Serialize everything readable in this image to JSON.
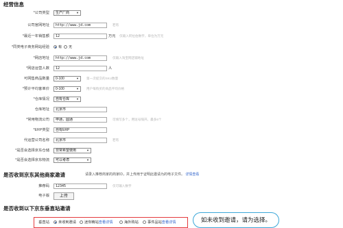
{
  "sections": {
    "business": "经营信息",
    "invite_other": "是否收到京东其他商家邀请",
    "invite_vertical": "是否收到以下京东垂直站邀请"
  },
  "fields": {
    "company_type": {
      "label": "*公司类型",
      "value": "生产厂商"
    },
    "website": {
      "label": "公司官网地址",
      "value": "http://www.jd.com",
      "hint": "若有"
    },
    "sales": {
      "label": "*最近一年销售额",
      "value": "12",
      "unit": "万元",
      "hint": "仅输入阿拉伯数字，单位为万元"
    },
    "online_store": {
      "label": "*同类电子商务网站经验",
      "yes": "有",
      "no": "无"
    },
    "store_url": {
      "label": "*网店地址",
      "value": "http://www.jd.com",
      "hint": "仅输入淘宝网店铺地址"
    },
    "ops_staff": {
      "label": "*网店运营人数",
      "value": "12",
      "unit": "人"
    },
    "sku_count": {
      "label": "可网售商品数量",
      "value": "0-100",
      "hint": "第一次提交的SKU数量"
    },
    "avg_price": {
      "label": "*预计平均客单价",
      "value": "0-100",
      "hint": "用户每购买的商品平均价格"
    },
    "warehouse": {
      "label": "*仓库情况",
      "value": "自有仓库"
    },
    "warehouse_addr": {
      "label": "仓库地址",
      "value": "北京市"
    },
    "courier": {
      "label": "*常用物流公司",
      "value": "申通，圆通",
      "hint": "可填写多个，用逗号隔开。最多5个"
    },
    "erp": {
      "label": "*ERP类型",
      "value": "自有ERP"
    },
    "agent": {
      "label": "代运营公司名称",
      "value": "北京市",
      "hint": "若有"
    },
    "jd_warehouse": {
      "label": "*是否会选择京东仓储",
      "value": "非常希望使用"
    },
    "jd_logistics": {
      "label": "*是否会选择京东物流",
      "value": "可以考虑"
    }
  },
  "invite_other": {
    "desc": "请录入推荐商家的商家ID，并上传用于证明此邀请为的电子文件。",
    "desc_link": "详情查看",
    "code": {
      "label": "推荐码",
      "value": "12345",
      "hint": "仅可输入数字"
    },
    "file": {
      "label": "电子版",
      "button": "上传"
    }
  },
  "invite_vertical": {
    "label": "垂直站",
    "options": [
      {
        "text": "未收到邀请",
        "link": "",
        "checked": true
      },
      {
        "text": "迷你精站",
        "link": "查看详情",
        "checked": false
      },
      {
        "text": "海外购站",
        "link": "",
        "checked": false
      },
      {
        "text": "事件品站",
        "link": "查看详情",
        "checked": false
      }
    ]
  },
  "callout": "如未收到邀请，请为选择。"
}
